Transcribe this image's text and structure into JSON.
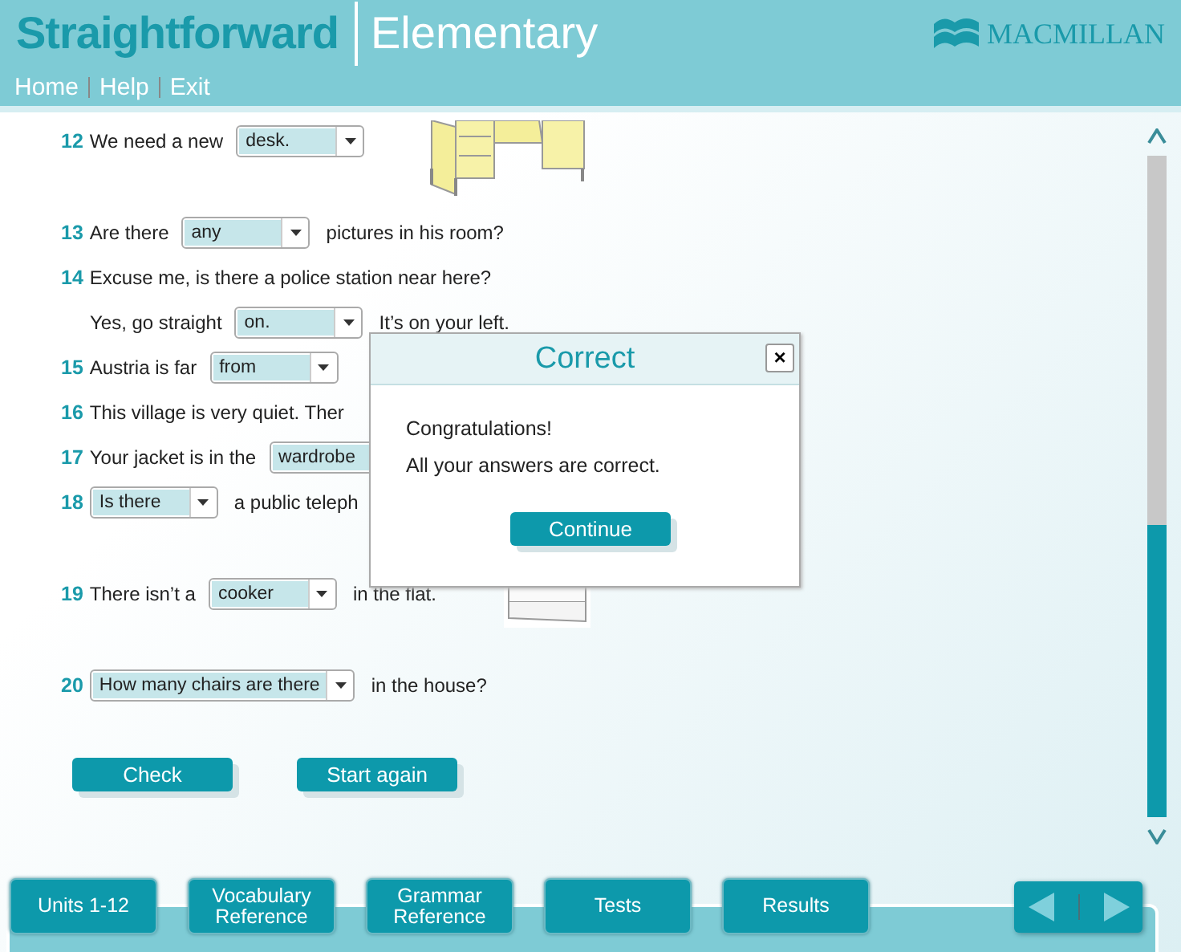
{
  "header": {
    "title": "Straightforward",
    "subtitle": "Elementary",
    "publisher": "MACMILLAN",
    "nav": [
      "Home",
      "Help",
      "Exit"
    ]
  },
  "questions": [
    {
      "number": "12",
      "parts": [
        {
          "kind": "text",
          "text": "We need a new"
        },
        {
          "kind": "select",
          "value": "desk."
        }
      ],
      "image": {
        "kind": "picture"
      }
    },
    {
      "number": "13",
      "parts": [
        {
          "kind": "text",
          "text": "Are there"
        },
        {
          "kind": "select",
          "value": "any"
        },
        {
          "kind": "text",
          "text": "pictures in his room?"
        }
      ]
    },
    {
      "number": "14",
      "parts": [
        {
          "kind": "text",
          "text": "Excuse me, is there a police station near here?"
        }
      ]
    },
    {
      "parts": [
        {
          "kind": "text",
          "text": "Yes, go straight"
        },
        {
          "kind": "select",
          "value": "on."
        },
        {
          "kind": "text",
          "text": "It’s on your left."
        }
      ]
    },
    {
      "number": "15",
      "parts": [
        {
          "kind": "text",
          "text": "Austria is far"
        },
        {
          "kind": "select",
          "value": "from"
        }
      ]
    },
    {
      "number": "16",
      "parts": [
        {
          "kind": "text",
          "text": "This village is very quiet. Ther"
        }
      ]
    },
    {
      "number": "17",
      "parts": [
        {
          "kind": "text",
          "text": "Your jacket is in the"
        },
        {
          "kind": "select",
          "value": "wardrobe"
        }
      ]
    },
    {
      "number": "18",
      "parts": [
        {
          "kind": "select",
          "value": "Is there"
        },
        {
          "kind": "text",
          "text": "a public teleph"
        }
      ]
    },
    {
      "number": "19",
      "parts": [
        {
          "kind": "text",
          "text": "There isn’t a"
        },
        {
          "kind": "select",
          "value": "cooker"
        },
        {
          "kind": "text",
          "text": "in the flat."
        }
      ],
      "image": {
        "kind": "picture"
      }
    },
    {
      "number": "20",
      "parts": [
        {
          "kind": "select",
          "value": "How many chairs are there"
        },
        {
          "kind": "text",
          "text": "in the house?"
        }
      ]
    }
  ],
  "actions": [
    "Check",
    "Start again"
  ],
  "dialog": {
    "title": "Correct",
    "lines": [
      "Congratulations!",
      "All your answers are correct."
    ],
    "button": "Continue",
    "close": "×"
  },
  "footer": {
    "tabs": [
      "Units 1-12",
      "Vocabulary Reference",
      "Grammar Reference",
      "Tests",
      "Results"
    ]
  }
}
